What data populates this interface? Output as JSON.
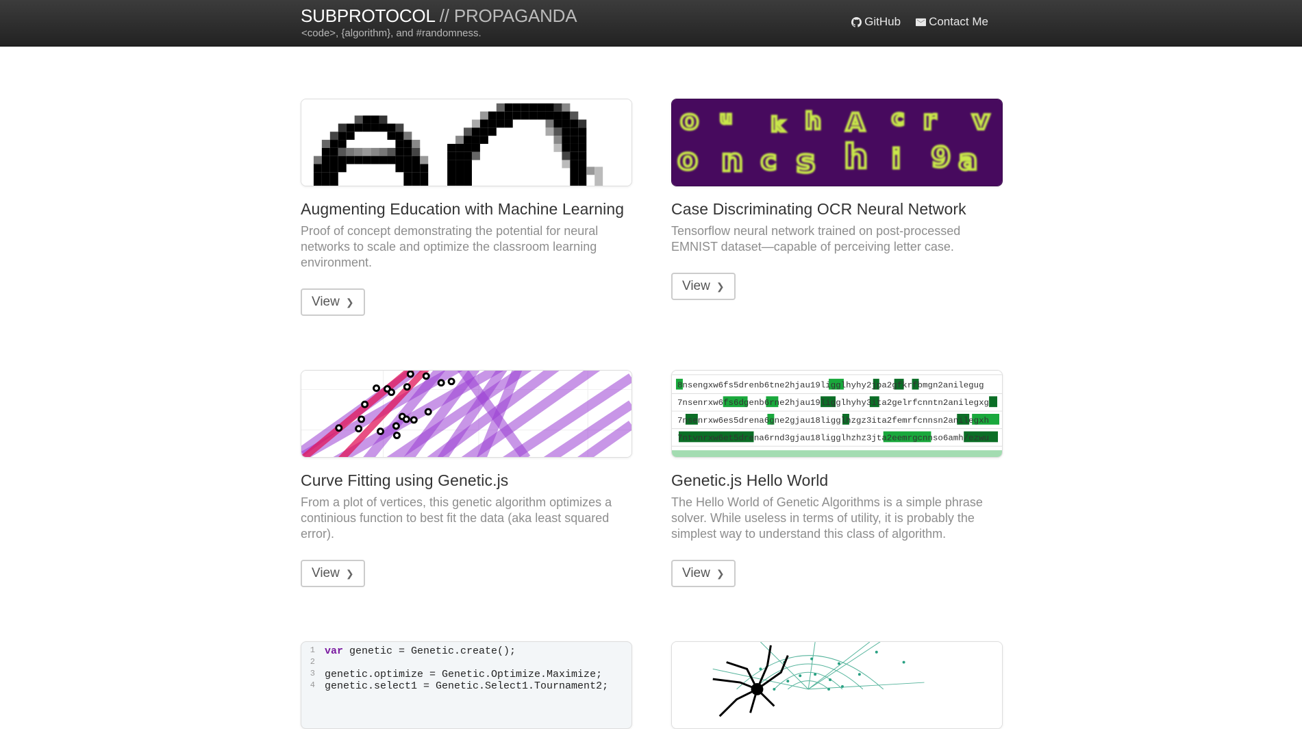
{
  "header": {
    "brand_main": "SUBPROTOCOL",
    "brand_sep": " // ",
    "brand_sub": "PROPAGANDA",
    "tagline": "<code>, {algorithm}, and #randomness.",
    "nav": [
      {
        "label": "GitHub",
        "icon": "github-icon"
      },
      {
        "label": "Contact Me",
        "icon": "envelope-icon"
      }
    ]
  },
  "projects": [
    {
      "title": "Augmenting Education with Machine Learning",
      "description": "Proof of concept demonstrating the potential for neural networks to scale and optimize the classroom learning environment.",
      "button": "View"
    },
    {
      "title": "Case Discriminating OCR Neural Network",
      "description": "Tensorflow neural network trained on post-processed EMNIST dataset—capable of perceiving letter case.",
      "button": "View"
    },
    {
      "title": "Curve Fitting using Genetic.js",
      "description": "From a plot of vertices, this genetic algorithm optimizes a continious function to best fit the data (aka least squared error).",
      "button": "View"
    },
    {
      "title": "Genetic.js Hello World",
      "description": "The Hello World of Genetic Algorithms is a simple phrase solver. While useless in terms of utility, it is probably the simplest way to understand this class of algorithm.",
      "button": "View"
    }
  ],
  "ocr_thumb": {
    "row1": [
      "o",
      "u",
      "k",
      "h",
      "A",
      "c",
      "r",
      "v"
    ],
    "row2": [
      "o",
      "n",
      "c",
      "s",
      "h",
      "i",
      "9",
      "a"
    ]
  },
  "genetic_thumb": {
    "lines": [
      "8nsengxw6fs5drenb6tne2hjau19ligglhyhy2jpa2gfkrfbmgn2anilegug",
      "7nsenrxw6fs6dgenb6rne2hjau19ligglhyhy3ita2gelrfcnntn2anilegxg",
      "7nsenrxw6es5drena6gne2gjau18ligglhzgz3ita2femrfcnnsn2anilegxh",
      "7ntvnrxw6et5drena6rnd3gjau18ligglhzhz3jta2eemrgcnnso6amh/ezwu"
    ]
  },
  "code_thumb": {
    "lines": [
      {
        "num": "1",
        "kw": "var",
        "text": " genetic = Genetic.create();"
      },
      {
        "num": "2",
        "kw": "",
        "text": ""
      },
      {
        "num": "3",
        "kw": "",
        "text": "genetic.optimize = Genetic.Optimize.Maximize;"
      },
      {
        "num": "4",
        "kw": "",
        "text": "genetic.select1 = Genetic.Select1.Tournament2;"
      }
    ]
  },
  "colors": {
    "ocr_bg": "#470a5e",
    "ocr_glyph": "#c9e84a",
    "curve_purple": "#9b3fd3",
    "curve_red": "#e0155a",
    "match_green": "#19a83c",
    "code_keyword": "#7a1aa0"
  }
}
